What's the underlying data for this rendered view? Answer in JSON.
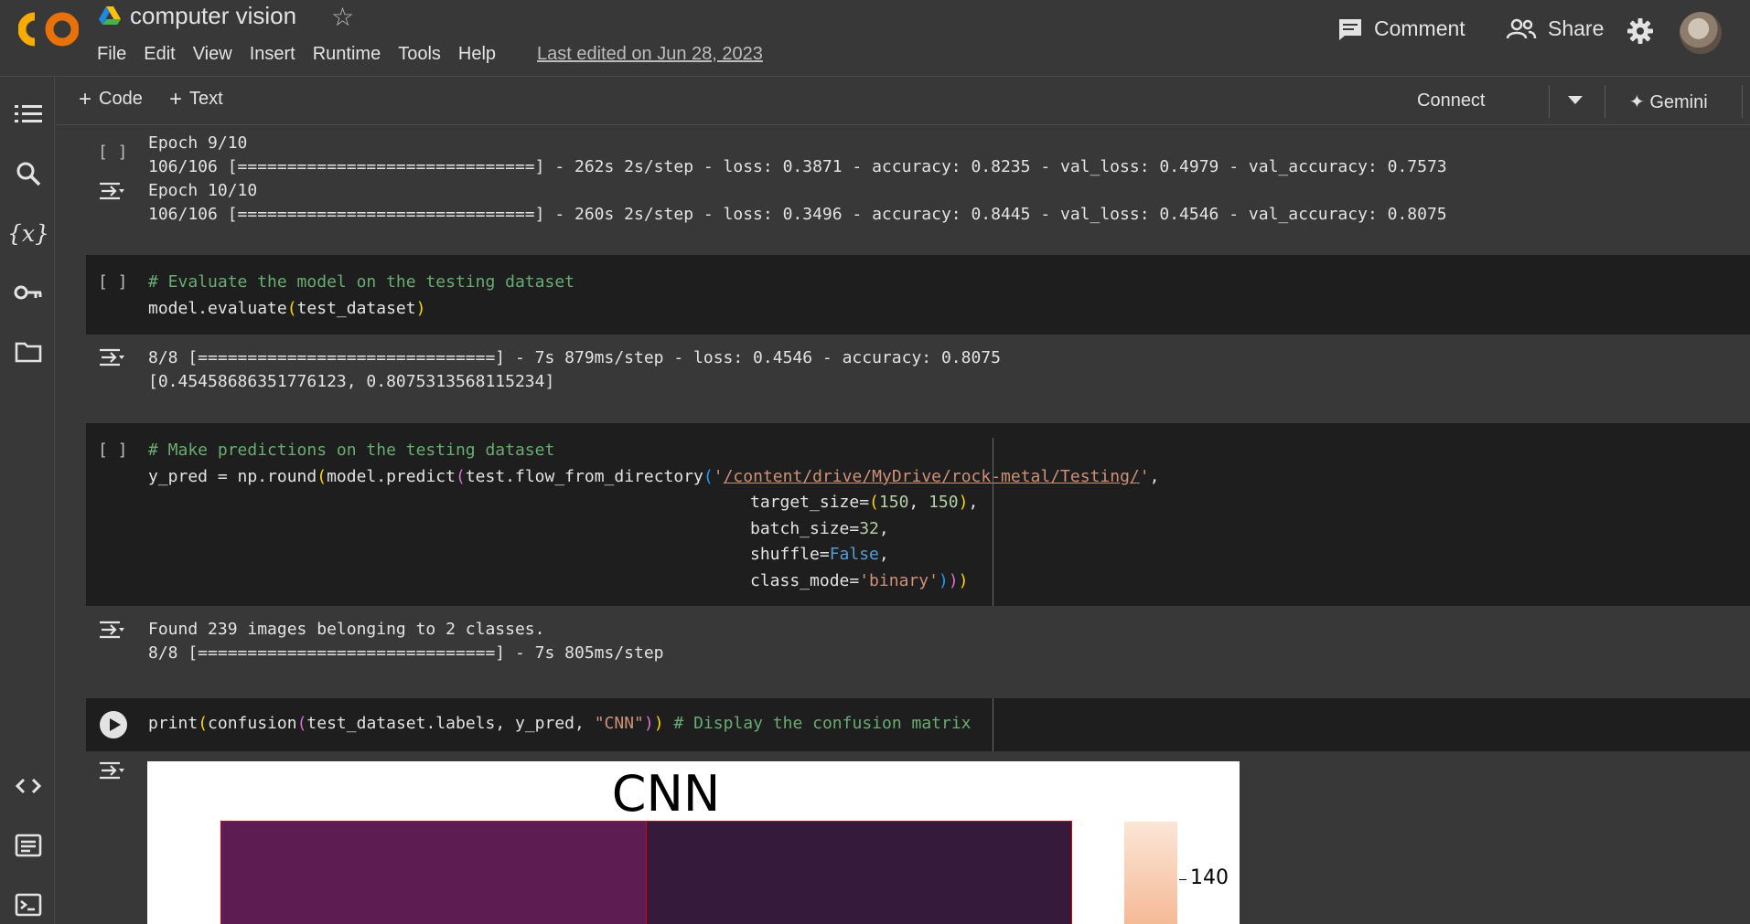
{
  "header": {
    "notebook_title": "computer vision",
    "menu": [
      "File",
      "Edit",
      "View",
      "Insert",
      "Runtime",
      "Tools",
      "Help"
    ],
    "last_edited": "Last edited on Jun 28, 2023",
    "comment_label": "Comment",
    "share_label": "Share",
    "logo_text": "CO"
  },
  "toolbar": {
    "add_code": "Code",
    "add_text": "Text",
    "connect": "Connect",
    "gemini": "Gemini"
  },
  "cells": {
    "training_output": {
      "bracket": "[ ]",
      "lines": [
        "Epoch 9/10",
        "106/106 [==============================] - 262s 2s/step - loss: 0.3871 - accuracy: 0.8235 - val_loss: 0.4979 - val_accuracy: 0.7573",
        "Epoch 10/10",
        "106/106 [==============================] - 260s 2s/step - loss: 0.3496 - accuracy: 0.8445 - val_loss: 0.4546 - val_accuracy: 0.8075"
      ]
    },
    "evaluate": {
      "bracket": "[ ]",
      "comment": "# Evaluate the model on the testing dataset",
      "code_fn": "model.evaluate",
      "code_open": "(",
      "code_arg": "test_dataset",
      "code_close": ")",
      "output": [
        "8/8 [==============================] - 7s 879ms/step - loss: 0.4546 - accuracy: 0.8075",
        "[0.45458686351776123, 0.8075313568115234]"
      ]
    },
    "predict": {
      "bracket": "[ ]",
      "comment": "# Make predictions on the testing dataset",
      "line1_a": "y_pred = np.round",
      "line1_b": "(",
      "line1_c": "model.predict",
      "line1_d": "(",
      "line1_e": "test.flow_from_directory",
      "line1_f": "(",
      "line1_q": "'",
      "line1_path1": "/content/drive/MyDrive",
      "line1_path2": "/rock-metal/Testing/",
      "line1_q2": "'",
      "line1_comma": ",",
      "line2_a": "target_size=",
      "line2_b": "(",
      "line2_c": "150",
      "line2_d": ", ",
      "line2_e": "150",
      "line2_f": ")",
      "line2_g": ",",
      "line3_a": "batch_size=",
      "line3_b": "32",
      "line3_c": ",",
      "line4_a": "shuffle=",
      "line4_b": "False",
      "line4_c": ",",
      "line5_a": "class_mode=",
      "line5_b": "'binary'",
      "line5_c": ")",
      "line5_d": ")",
      "line5_e": ")",
      "output": [
        "Found 239 images belonging to 2 classes.",
        "8/8 [==============================] - 7s 805ms/step"
      ]
    },
    "confusion": {
      "fn": "print",
      "open": "(",
      "call": "confusion",
      "open2": "(",
      "args": "test_dataset.labels, y_pred, ",
      "str": "\"CNN\"",
      "close2": ")",
      "close": ")",
      "comment": " # Display the confusion matrix"
    }
  },
  "figure": {
    "title": "CNN",
    "colorbar_tick": "140",
    "cell_colors": [
      "#5e1d52",
      "#361a3c"
    ],
    "colorbar_colors": [
      "#fbe6d7",
      "#f4b38c"
    ]
  },
  "colors": {
    "background": "#383838",
    "code_background": "#1e1e1e",
    "comment": "#6aab73",
    "string": "#ce9178",
    "number": "#b5cea8",
    "keyword": "#569cd6",
    "logo": "#f9ab00"
  },
  "icons": {
    "rail": [
      "table-of-contents-icon",
      "search-icon",
      "variables-icon",
      "secrets-key-icon",
      "files-folder-icon",
      "code-snippets-icon",
      "command-palette-icon",
      "terminal-icon"
    ]
  }
}
